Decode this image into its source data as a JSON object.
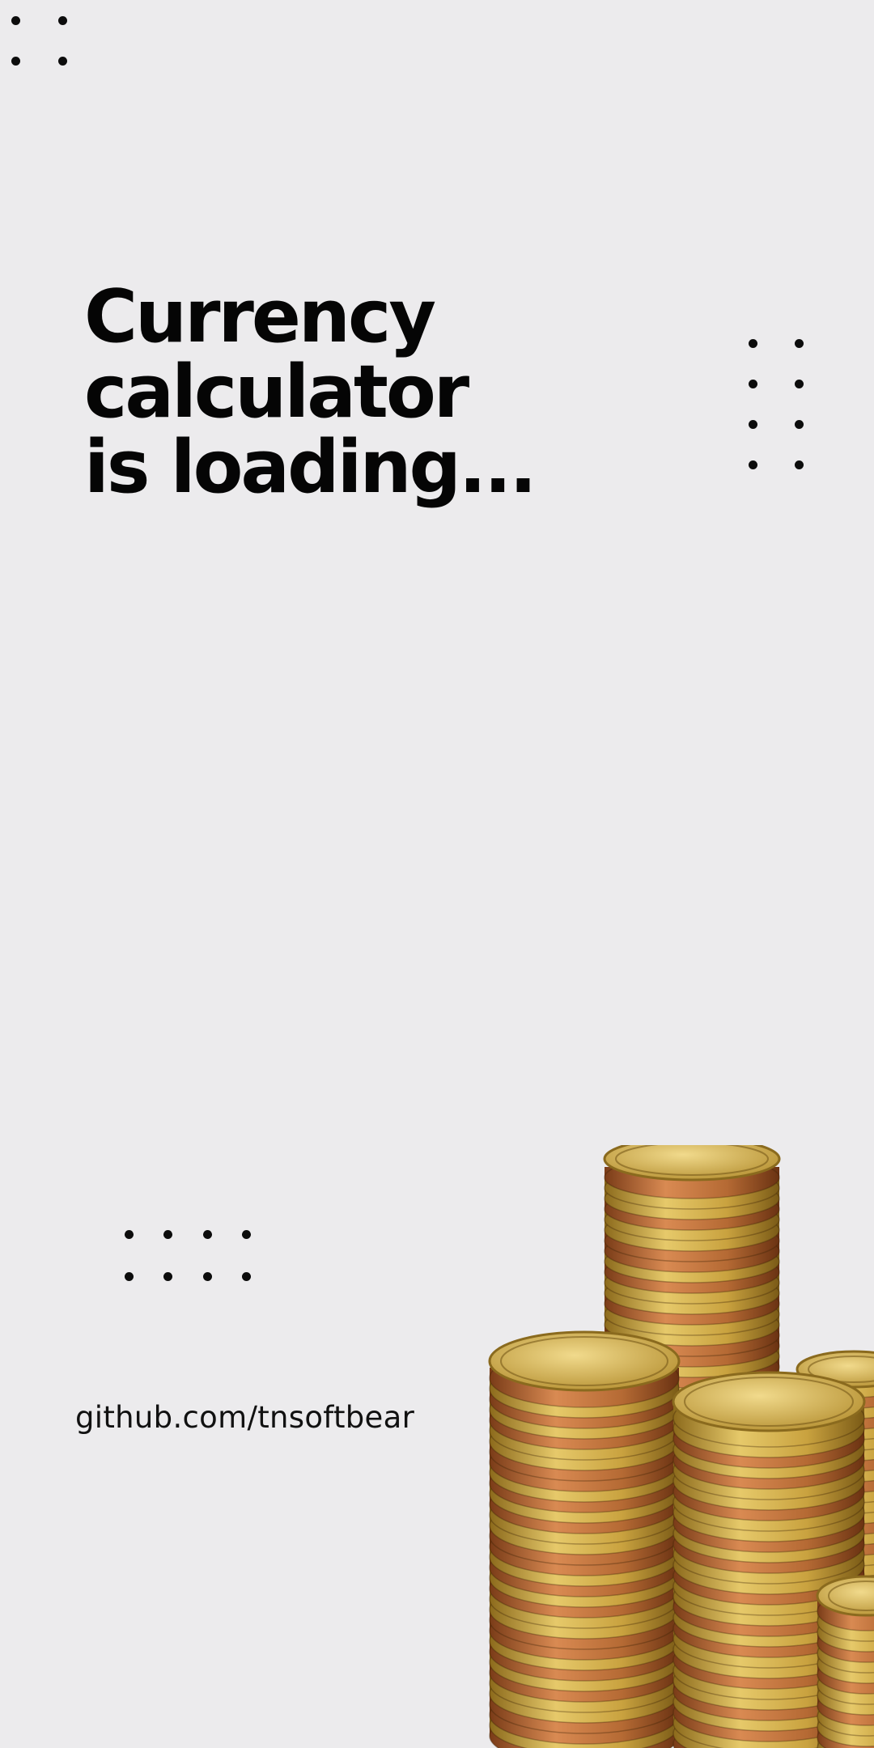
{
  "splash": {
    "headline": [
      "Currency",
      "calculator",
      "is loading..."
    ],
    "link_text": "github.com/tnsoftbear"
  },
  "decorations": {
    "dot_color": "#0c0c0c",
    "background": "#ecebed",
    "image": "stacks-of-gold-and-copper-coins"
  }
}
